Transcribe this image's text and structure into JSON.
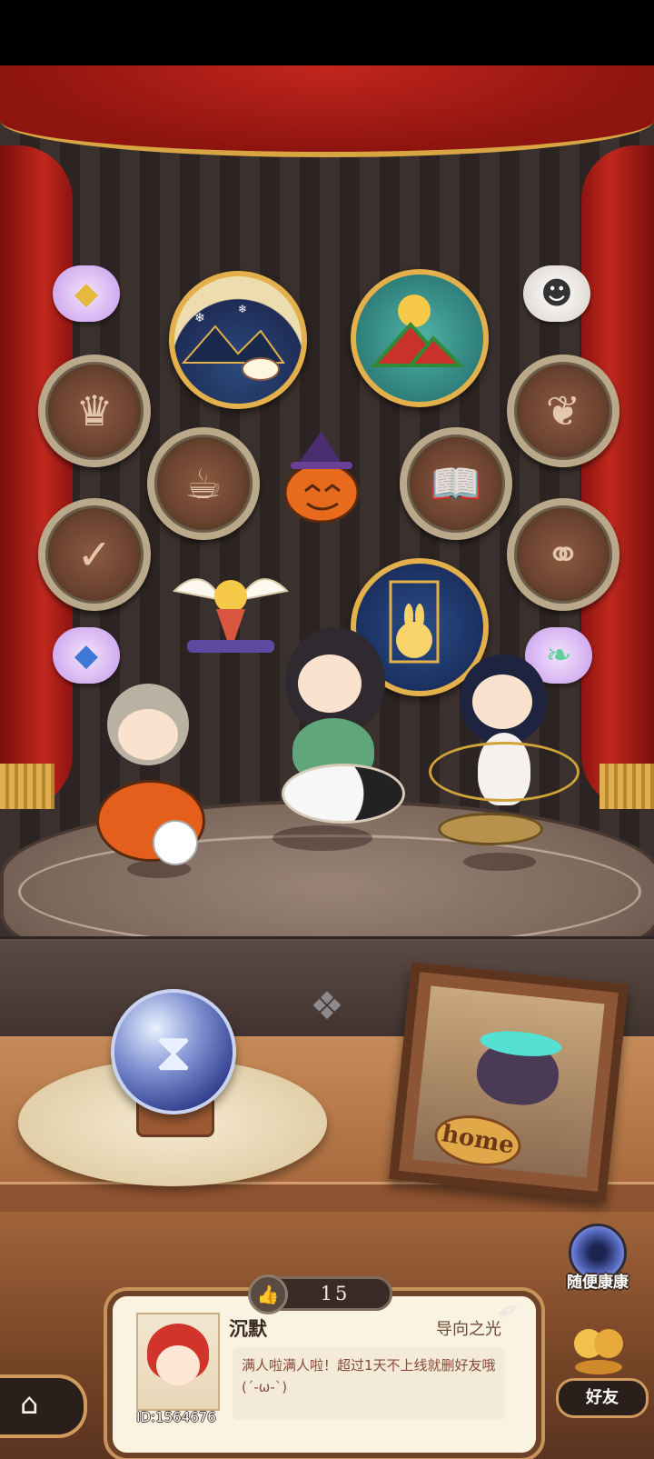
{
  "app": {
    "scene": "personal-theater"
  },
  "badges": {
    "left_column": [
      {
        "icon": "crown-trophy-icon",
        "glyph": "♛"
      },
      {
        "icon": "scroll-check-icon",
        "glyph": "✓"
      }
    ],
    "right_column": [
      {
        "icon": "ornament-icon",
        "glyph": "❦"
      },
      {
        "icon": "two-figures-icon",
        "glyph": "⚭"
      }
    ],
    "middle": [
      {
        "icon": "cauldron-icon",
        "glyph": "☕"
      },
      {
        "icon": "book-icon",
        "glyph": "📖"
      }
    ],
    "large": [
      {
        "icon": "snowy-mountain-tea-icon"
      },
      {
        "icon": "watermelon-sun-icon"
      },
      {
        "icon": "rabbit-moon-icon"
      }
    ],
    "special": [
      {
        "icon": "pumpkin-witch-hat-icon"
      },
      {
        "icon": "winged-ice-cream-icon"
      }
    ],
    "bubbles": [
      {
        "icon": "gem-topaz-icon",
        "glyph": "◆",
        "color": "#e6b83c"
      },
      {
        "icon": "gem-sapphire-icon",
        "glyph": "◆",
        "color": "#3d78d6"
      },
      {
        "icon": "leaf-icon",
        "glyph": "❧",
        "color": "#5fcf9a"
      },
      {
        "icon": "ghost-icon",
        "glyph": "☻",
        "color": "#f4f4f4"
      }
    ]
  },
  "characters": [
    {
      "name": "pumpkin-rider",
      "hair": "#b9b2a3",
      "body": "#e55f1c"
    },
    {
      "name": "yin-yang-fisher",
      "hair": "#2e2a30",
      "body": "#5fa77a"
    },
    {
      "name": "orbit-dancer",
      "hair": "#1e2440",
      "body": "#f4f1ee"
    }
  ],
  "hourglass_orb": {
    "icon": "hourglass-icon",
    "glyph": "⧗"
  },
  "home_frame": {
    "label": "home"
  },
  "random_visit": {
    "label": "随便康康"
  },
  "likes": {
    "count": "15",
    "icon": "thumbs-up-icon",
    "glyph": "👍"
  },
  "profile": {
    "name": "沉默",
    "title": "导向之光",
    "bio": "满人啦满人啦！超过1天不上线就删好友哦(´-ω-`)",
    "uid": "ID:1564676"
  },
  "nav": {
    "home_icon": "⌂",
    "friends_label": "好友",
    "quill": "✒"
  }
}
